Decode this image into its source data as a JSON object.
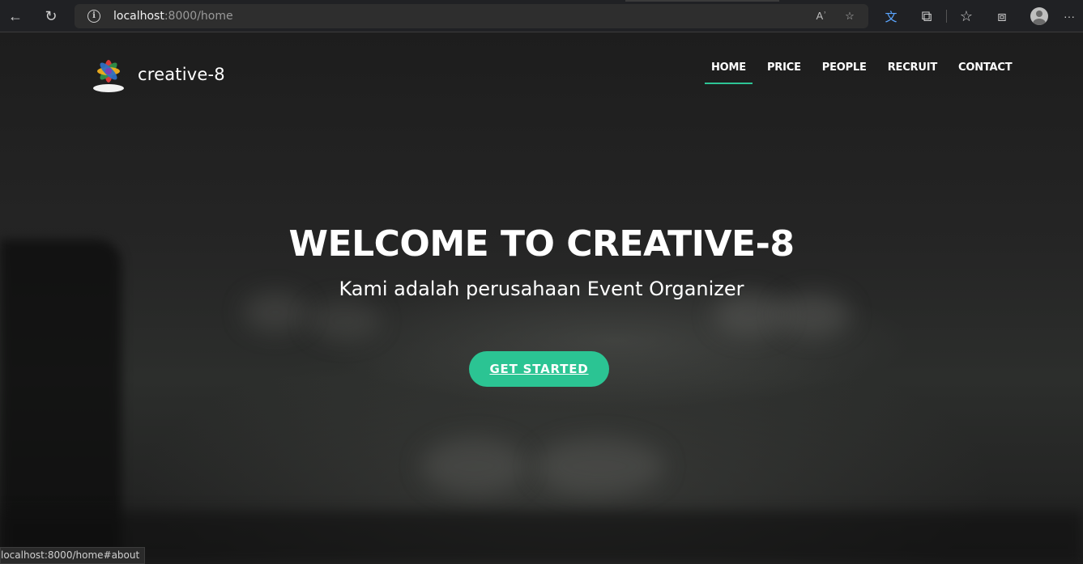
{
  "browser": {
    "url_host": "localhost",
    "url_rest": ":8000/home",
    "icons": [
      "back-arrow-icon",
      "refresh-icon",
      "site-info-icon",
      "read-aloud-icon",
      "add-favorite-icon",
      "translate-icon",
      "extensions-icon",
      "favorites-icon",
      "collections-icon",
      "profile-icon",
      "more-icon"
    ],
    "glyphs": {
      "back": "←",
      "refresh": "↻",
      "info": "i",
      "read_aloud": "Aʾ",
      "add_favorite": "☆",
      "translate": "文",
      "extensions": "⧉",
      "favorites": "☆",
      "collections": "⧈",
      "more": "···"
    }
  },
  "site": {
    "brand": "creative-8",
    "nav": [
      "HOME",
      "PRICE",
      "PEOPLE",
      "RECRUIT",
      "CONTACT"
    ],
    "active_nav": "HOME",
    "accent": "#2bc493"
  },
  "hero": {
    "title": "WELCOME TO CREATIVE-8",
    "subtitle": "Kami adalah perusahaan Event Organizer",
    "cta": "GET STARTED"
  },
  "status_bar": {
    "text": "localhost:8000/home#about"
  }
}
